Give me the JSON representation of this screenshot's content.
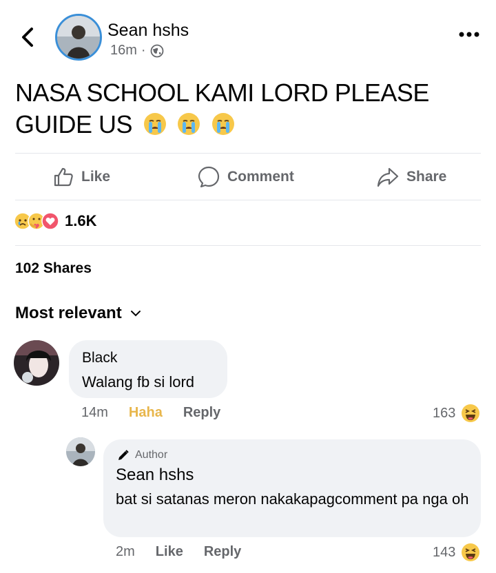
{
  "header": {
    "author": "Sean hshs",
    "time": "16m",
    "separator": "·",
    "privacy_icon": "globe-icon"
  },
  "post": {
    "text": "NASA SCHOOL KAMI LORD PLEASE GUIDE US",
    "emojis": [
      "crying-face-emoji",
      "crying-face-emoji",
      "crying-face-emoji"
    ]
  },
  "actions": {
    "like": "Like",
    "comment": "Comment",
    "share": "Share"
  },
  "reactions": {
    "icons": [
      "sad-react-icon",
      "care-react-icon",
      "love-react-icon"
    ],
    "count": "1.6K"
  },
  "shares": "102 Shares",
  "sort": {
    "label": "Most relevant"
  },
  "comments": [
    {
      "name": "Black",
      "text": "Walang fb si lord",
      "time": "14m",
      "reaction_label": "Haha",
      "reply": "Reply",
      "count": "163",
      "react_icon": "haha-react-icon"
    },
    {
      "badge": "Author",
      "name": "Sean hshs",
      "text": "bat si satanas meron nakakapagcomment pa nga oh",
      "time": "2m",
      "like": "Like",
      "reply": "Reply",
      "count": "143",
      "react_icon": "haha-react-icon"
    }
  ],
  "colors": {
    "accent_ring": "#3a8fd8",
    "muted_text": "#65676b",
    "bubble_bg": "#f0f2f5",
    "haha_color": "#e8b64b"
  }
}
